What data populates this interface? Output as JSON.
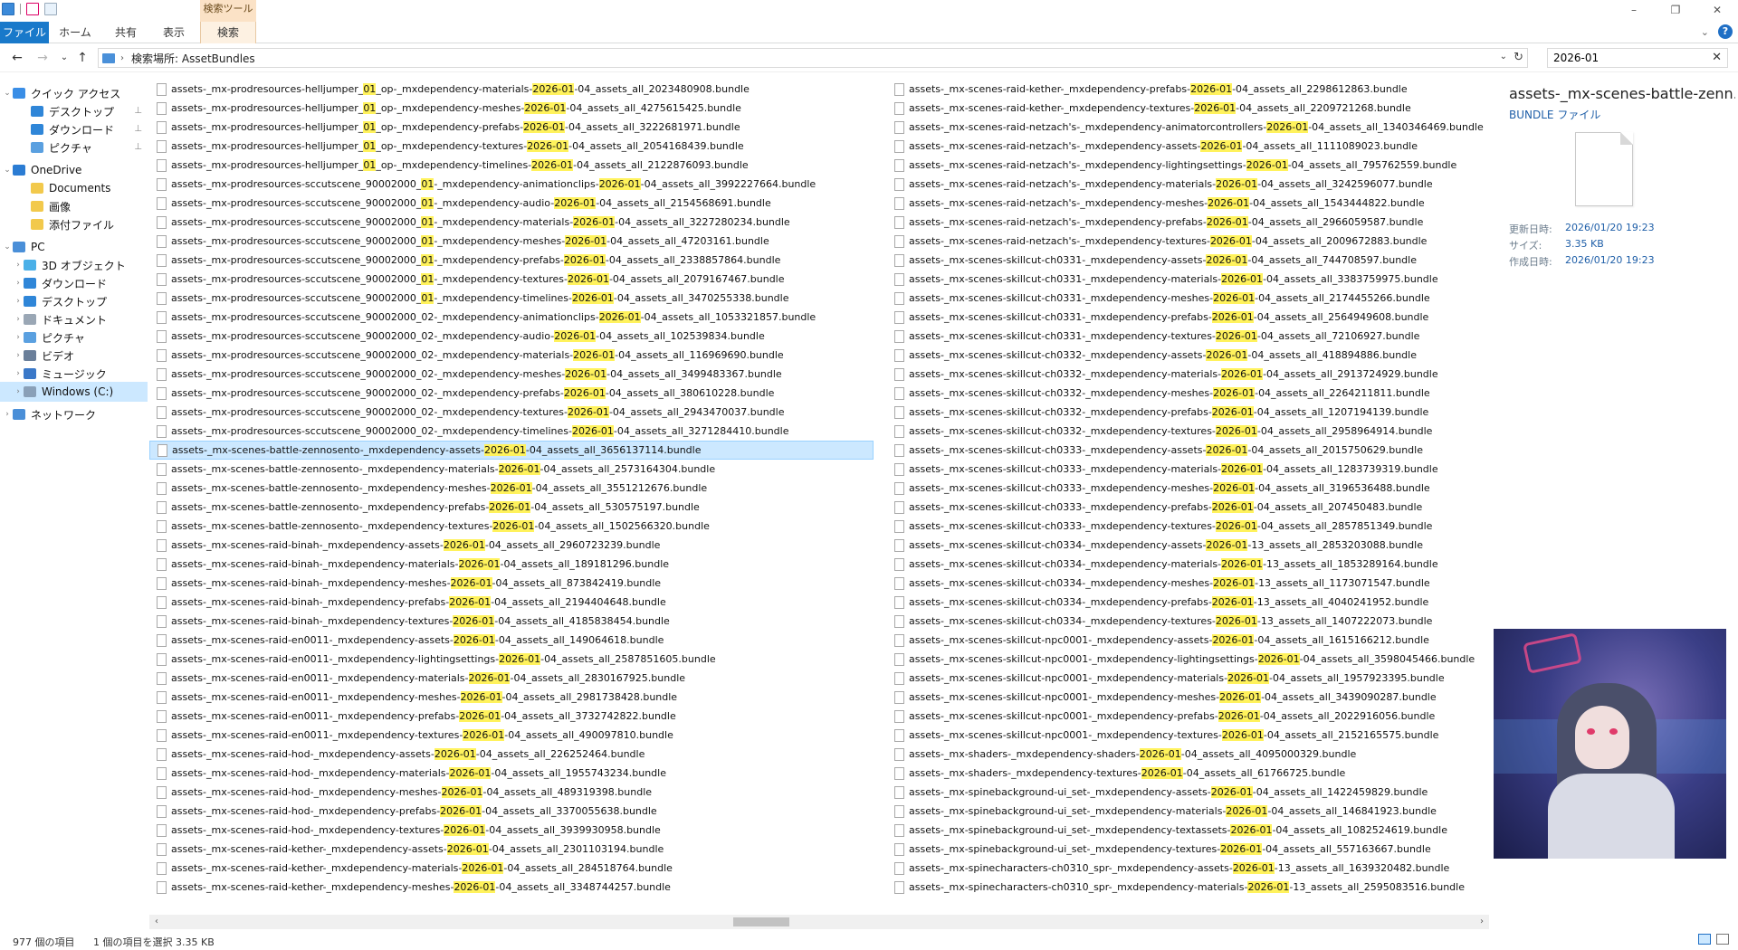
{
  "titlebar": {
    "context_tab_header": "検索ツール",
    "minimize": "–",
    "maximize": "❐",
    "close": "✕"
  },
  "ribbon": {
    "tabs": [
      "ファイル",
      "ホーム",
      "共有",
      "表示",
      "検索"
    ]
  },
  "address": {
    "back": "←",
    "forward": "→",
    "recent": "⌄",
    "up": "↑",
    "separator": "›",
    "path": "検索場所: AssetBundles",
    "dropdown": "⌄",
    "refresh": "↻"
  },
  "search": {
    "value": "2026-01",
    "clear": "✕"
  },
  "nav": {
    "items": [
      {
        "label": "クイック アクセス",
        "icon": "star-icon",
        "expander": "⌄"
      },
      {
        "label": "デスクトップ",
        "icon": "desktop-icon",
        "pin": "📌"
      },
      {
        "label": "ダウンロード",
        "icon": "download-icon",
        "pin": "📌"
      },
      {
        "label": "ピクチャ",
        "icon": "pictures-icon",
        "pin": "📌"
      },
      {
        "label": "OneDrive",
        "icon": "cloud-icon",
        "expander": "⌄"
      },
      {
        "label": "Documents",
        "icon": "folder-icon"
      },
      {
        "label": "画像",
        "icon": "folder-icon"
      },
      {
        "label": "添付ファイル",
        "icon": "folder-icon"
      },
      {
        "label": "PC",
        "icon": "pc-icon",
        "expander": "⌄"
      },
      {
        "label": "3D オブジェクト",
        "icon": "3d-objects-icon",
        "expander": "›"
      },
      {
        "label": "ダウンロード",
        "icon": "download-icon",
        "expander": "›"
      },
      {
        "label": "デスクトップ",
        "icon": "desktop-icon",
        "expander": "›"
      },
      {
        "label": "ドキュメント",
        "icon": "documents-icon",
        "expander": "›"
      },
      {
        "label": "ピクチャ",
        "icon": "pictures-icon",
        "expander": "›"
      },
      {
        "label": "ビデオ",
        "icon": "videos-icon",
        "expander": "›"
      },
      {
        "label": "ミュージック",
        "icon": "music-icon",
        "expander": "›"
      },
      {
        "label": "Windows (C:)",
        "icon": "drive-icon",
        "expander": "›"
      },
      {
        "label": "ネットワーク",
        "icon": "network-icon",
        "expander": "›"
      }
    ]
  },
  "files": {
    "highlight": "2026-01",
    "column1": [
      [
        "assets-_mx-prodresources-helljumper_",
        "01",
        "_op-_mxdependency-materials-",
        "2026-01",
        "-04_assets_all_2023480908.bundle"
      ],
      [
        "assets-_mx-prodresources-helljumper_",
        "01",
        "_op-_mxdependency-meshes-",
        "2026-01",
        "-04_assets_all_4275615425.bundle"
      ],
      [
        "assets-_mx-prodresources-helljumper_",
        "01",
        "_op-_mxdependency-prefabs-",
        "2026-01",
        "-04_assets_all_3222681971.bundle"
      ],
      [
        "assets-_mx-prodresources-helljumper_",
        "01",
        "_op-_mxdependency-textures-",
        "2026-01",
        "-04_assets_all_2054168439.bundle"
      ],
      [
        "assets-_mx-prodresources-helljumper_",
        "01",
        "_op-_mxdependency-timelines-",
        "2026-01",
        "-04_assets_all_2122876093.bundle"
      ],
      [
        "assets-_mx-prodresources-sccutscene_90002000_",
        "01",
        "-_mxdependency-animationclips-",
        "2026-01",
        "-04_assets_all_3992227664.bundle"
      ],
      [
        "assets-_mx-prodresources-sccutscene_90002000_",
        "01",
        "-_mxdependency-audio-",
        "2026-01",
        "-04_assets_all_2154568691.bundle"
      ],
      [
        "assets-_mx-prodresources-sccutscene_90002000_",
        "01",
        "-_mxdependency-materials-",
        "2026-01",
        "-04_assets_all_3227280234.bundle"
      ],
      [
        "assets-_mx-prodresources-sccutscene_90002000_",
        "01",
        "-_mxdependency-meshes-",
        "2026-01",
        "-04_assets_all_47203161.bundle"
      ],
      [
        "assets-_mx-prodresources-sccutscene_90002000_",
        "01",
        "-_mxdependency-prefabs-",
        "2026-01",
        "-04_assets_all_2338857864.bundle"
      ],
      [
        "assets-_mx-prodresources-sccutscene_90002000_",
        "01",
        "-_mxdependency-textures-",
        "2026-01",
        "-04_assets_all_2079167467.bundle"
      ],
      [
        "assets-_mx-prodresources-sccutscene_90002000_",
        "01",
        "-_mxdependency-timelines-",
        "2026-01",
        "-04_assets_all_3470255338.bundle"
      ],
      [
        "assets-_mx-prodresources-sccutscene_90002000_02-_mxdependency-animationclips-",
        "",
        "",
        "2026-01",
        "-04_assets_all_1053321857.bundle"
      ],
      [
        "assets-_mx-prodresources-sccutscene_90002000_02-_mxdependency-audio-",
        "",
        "",
        "2026-01",
        "-04_assets_all_102539834.bundle"
      ],
      [
        "assets-_mx-prodresources-sccutscene_90002000_02-_mxdependency-materials-",
        "",
        "",
        "2026-01",
        "-04_assets_all_116969690.bundle"
      ],
      [
        "assets-_mx-prodresources-sccutscene_90002000_02-_mxdependency-meshes-",
        "",
        "",
        "2026-01",
        "-04_assets_all_3499483367.bundle"
      ],
      [
        "assets-_mx-prodresources-sccutscene_90002000_02-_mxdependency-prefabs-",
        "",
        "",
        "2026-01",
        "-04_assets_all_380610228.bundle"
      ],
      [
        "assets-_mx-prodresources-sccutscene_90002000_02-_mxdependency-textures-",
        "",
        "",
        "2026-01",
        "-04_assets_all_2943470037.bundle"
      ],
      [
        "assets-_mx-prodresources-sccutscene_90002000_02-_mxdependency-timelines-",
        "",
        "",
        "2026-01",
        "-04_assets_all_3271284410.bundle"
      ],
      [
        "assets-_mx-scenes-battle-zennosento-_mxdependency-assets-",
        "",
        "",
        "2026-01",
        "-04_assets_all_3656137114.bundle"
      ],
      [
        "assets-_mx-scenes-battle-zennosento-_mxdependency-materials-",
        "",
        "",
        "2026-01",
        "-04_assets_all_2573164304.bundle"
      ],
      [
        "assets-_mx-scenes-battle-zennosento-_mxdependency-meshes-",
        "",
        "",
        "2026-01",
        "-04_assets_all_3551212676.bundle"
      ],
      [
        "assets-_mx-scenes-battle-zennosento-_mxdependency-prefabs-",
        "",
        "",
        "2026-01",
        "-04_assets_all_530575197.bundle"
      ],
      [
        "assets-_mx-scenes-battle-zennosento-_mxdependency-textures-",
        "",
        "",
        "2026-01",
        "-04_assets_all_1502566320.bundle"
      ],
      [
        "assets-_mx-scenes-raid-binah-_mxdependency-assets-",
        "",
        "",
        "2026-01",
        "-04_assets_all_2960723239.bundle"
      ],
      [
        "assets-_mx-scenes-raid-binah-_mxdependency-materials-",
        "",
        "",
        "2026-01",
        "-04_assets_all_189181296.bundle"
      ],
      [
        "assets-_mx-scenes-raid-binah-_mxdependency-meshes-",
        "",
        "",
        "2026-01",
        "-04_assets_all_873842419.bundle"
      ],
      [
        "assets-_mx-scenes-raid-binah-_mxdependency-prefabs-",
        "",
        "",
        "2026-01",
        "-04_assets_all_2194404648.bundle"
      ],
      [
        "assets-_mx-scenes-raid-binah-_mxdependency-textures-",
        "",
        "",
        "2026-01",
        "-04_assets_all_4185838454.bundle"
      ],
      [
        "assets-_mx-scenes-raid-en0011-_mxdependency-assets-",
        "",
        "",
        "2026-01",
        "-04_assets_all_149064618.bundle"
      ],
      [
        "assets-_mx-scenes-raid-en0011-_mxdependency-lightingsettings-",
        "",
        "",
        "2026-01",
        "-04_assets_all_2587851605.bundle"
      ],
      [
        "assets-_mx-scenes-raid-en0011-_mxdependency-materials-",
        "",
        "",
        "2026-01",
        "-04_assets_all_2830167925.bundle"
      ],
      [
        "assets-_mx-scenes-raid-en0011-_mxdependency-meshes-",
        "",
        "",
        "2026-01",
        "-04_assets_all_2981738428.bundle"
      ],
      [
        "assets-_mx-scenes-raid-en0011-_mxdependency-prefabs-",
        "",
        "",
        "2026-01",
        "-04_assets_all_3732742822.bundle"
      ],
      [
        "assets-_mx-scenes-raid-en0011-_mxdependency-textures-",
        "",
        "",
        "2026-01",
        "-04_assets_all_490097810.bundle"
      ],
      [
        "assets-_mx-scenes-raid-hod-_mxdependency-assets-",
        "",
        "",
        "2026-01",
        "-04_assets_all_226252464.bundle"
      ],
      [
        "assets-_mx-scenes-raid-hod-_mxdependency-materials-",
        "",
        "",
        "2026-01",
        "-04_assets_all_1955743234.bundle"
      ],
      [
        "assets-_mx-scenes-raid-hod-_mxdependency-meshes-",
        "",
        "",
        "2026-01",
        "-04_assets_all_489319398.bundle"
      ],
      [
        "assets-_mx-scenes-raid-hod-_mxdependency-prefabs-",
        "",
        "",
        "2026-01",
        "-04_assets_all_3370055638.bundle"
      ],
      [
        "assets-_mx-scenes-raid-hod-_mxdependency-textures-",
        "",
        "",
        "2026-01",
        "-04_assets_all_3939930958.bundle"
      ],
      [
        "assets-_mx-scenes-raid-kether-_mxdependency-assets-",
        "",
        "",
        "2026-01",
        "-04_assets_all_2301103194.bundle"
      ],
      [
        "assets-_mx-scenes-raid-kether-_mxdependency-materials-",
        "",
        "",
        "2026-01",
        "-04_assets_all_284518764.bundle"
      ],
      [
        "assets-_mx-scenes-raid-kether-_mxdependency-meshes-",
        "",
        "",
        "2026-01",
        "-04_assets_all_3348744257.bundle"
      ]
    ],
    "column2": [
      [
        "assets-_mx-scenes-raid-kether-_mxdependency-prefabs-",
        "2026-01",
        "-04_assets_all_2298612863.bundle"
      ],
      [
        "assets-_mx-scenes-raid-kether-_mxdependency-textures-",
        "2026-01",
        "-04_assets_all_2209721268.bundle"
      ],
      [
        "assets-_mx-scenes-raid-netzach's-_mxdependency-animatorcontrollers-",
        "2026-01",
        "-04_assets_all_1340346469.bundle"
      ],
      [
        "assets-_mx-scenes-raid-netzach's-_mxdependency-assets-",
        "2026-01",
        "-04_assets_all_1111089023.bundle"
      ],
      [
        "assets-_mx-scenes-raid-netzach's-_mxdependency-lightingsettings-",
        "2026-01",
        "-04_assets_all_795762559.bundle"
      ],
      [
        "assets-_mx-scenes-raid-netzach's-_mxdependency-materials-",
        "2026-01",
        "-04_assets_all_3242596077.bundle"
      ],
      [
        "assets-_mx-scenes-raid-netzach's-_mxdependency-meshes-",
        "2026-01",
        "-04_assets_all_1543444822.bundle"
      ],
      [
        "assets-_mx-scenes-raid-netzach's-_mxdependency-prefabs-",
        "2026-01",
        "-04_assets_all_2966059587.bundle"
      ],
      [
        "assets-_mx-scenes-raid-netzach's-_mxdependency-textures-",
        "2026-01",
        "-04_assets_all_2009672883.bundle"
      ],
      [
        "assets-_mx-scenes-skillcut-ch0331-_mxdependency-assets-",
        "2026-01",
        "-04_assets_all_744708597.bundle"
      ],
      [
        "assets-_mx-scenes-skillcut-ch0331-_mxdependency-materials-",
        "2026-01",
        "-04_assets_all_3383759975.bundle"
      ],
      [
        "assets-_mx-scenes-skillcut-ch0331-_mxdependency-meshes-",
        "2026-01",
        "-04_assets_all_2174455266.bundle"
      ],
      [
        "assets-_mx-scenes-skillcut-ch0331-_mxdependency-prefabs-",
        "2026-01",
        "-04_assets_all_2564949608.bundle"
      ],
      [
        "assets-_mx-scenes-skillcut-ch0331-_mxdependency-textures-",
        "2026-01",
        "-04_assets_all_72106927.bundle"
      ],
      [
        "assets-_mx-scenes-skillcut-ch0332-_mxdependency-assets-",
        "2026-01",
        "-04_assets_all_418894886.bundle"
      ],
      [
        "assets-_mx-scenes-skillcut-ch0332-_mxdependency-materials-",
        "2026-01",
        "-04_assets_all_2913724929.bundle"
      ],
      [
        "assets-_mx-scenes-skillcut-ch0332-_mxdependency-meshes-",
        "2026-01",
        "-04_assets_all_2264211811.bundle"
      ],
      [
        "assets-_mx-scenes-skillcut-ch0332-_mxdependency-prefabs-",
        "2026-01",
        "-04_assets_all_1207194139.bundle"
      ],
      [
        "assets-_mx-scenes-skillcut-ch0332-_mxdependency-textures-",
        "2026-01",
        "-04_assets_all_2958964914.bundle"
      ],
      [
        "assets-_mx-scenes-skillcut-ch0333-_mxdependency-assets-",
        "2026-01",
        "-04_assets_all_2015750629.bundle"
      ],
      [
        "assets-_mx-scenes-skillcut-ch0333-_mxdependency-materials-",
        "2026-01",
        "-04_assets_all_1283739319.bundle"
      ],
      [
        "assets-_mx-scenes-skillcut-ch0333-_mxdependency-meshes-",
        "2026-01",
        "-04_assets_all_3196536488.bundle"
      ],
      [
        "assets-_mx-scenes-skillcut-ch0333-_mxdependency-prefabs-",
        "2026-01",
        "-04_assets_all_207450483.bundle"
      ],
      [
        "assets-_mx-scenes-skillcut-ch0333-_mxdependency-textures-",
        "2026-01",
        "-04_assets_all_2857851349.bundle"
      ],
      [
        "assets-_mx-scenes-skillcut-ch0334-_mxdependency-assets-",
        "2026-01",
        "-13_assets_all_2853203088.bundle"
      ],
      [
        "assets-_mx-scenes-skillcut-ch0334-_mxdependency-materials-",
        "2026-01",
        "-13_assets_all_1853289164.bundle"
      ],
      [
        "assets-_mx-scenes-skillcut-ch0334-_mxdependency-meshes-",
        "2026-01",
        "-13_assets_all_1173071547.bundle"
      ],
      [
        "assets-_mx-scenes-skillcut-ch0334-_mxdependency-prefabs-",
        "2026-01",
        "-13_assets_all_4040241952.bundle"
      ],
      [
        "assets-_mx-scenes-skillcut-ch0334-_mxdependency-textures-",
        "2026-01",
        "-13_assets_all_1407222073.bundle"
      ],
      [
        "assets-_mx-scenes-skillcut-npc0001-_mxdependency-assets-",
        "2026-01",
        "-04_assets_all_1615166212.bundle"
      ],
      [
        "assets-_mx-scenes-skillcut-npc0001-_mxdependency-lightingsettings-",
        "2026-01",
        "-04_assets_all_3598045466.bundle"
      ],
      [
        "assets-_mx-scenes-skillcut-npc0001-_mxdependency-materials-",
        "2026-01",
        "-04_assets_all_1957923395.bundle"
      ],
      [
        "assets-_mx-scenes-skillcut-npc0001-_mxdependency-meshes-",
        "2026-01",
        "-04_assets_all_3439090287.bundle"
      ],
      [
        "assets-_mx-scenes-skillcut-npc0001-_mxdependency-prefabs-",
        "2026-01",
        "-04_assets_all_2022916056.bundle"
      ],
      [
        "assets-_mx-scenes-skillcut-npc0001-_mxdependency-textures-",
        "2026-01",
        "-04_assets_all_2152165575.bundle"
      ],
      [
        "assets-_mx-shaders-_mxdependency-shaders-",
        "2026-01",
        "-04_assets_all_4095000329.bundle"
      ],
      [
        "assets-_mx-shaders-_mxdependency-textures-",
        "2026-01",
        "-04_assets_all_61766725.bundle"
      ],
      [
        "assets-_mx-spinebackground-ui_set-_mxdependency-assets-",
        "2026-01",
        "-04_assets_all_1422459829.bundle"
      ],
      [
        "assets-_mx-spinebackground-ui_set-_mxdependency-materials-",
        "2026-01",
        "-04_assets_all_146841923.bundle"
      ],
      [
        "assets-_mx-spinebackground-ui_set-_mxdependency-textassets-",
        "2026-01",
        "-04_assets_all_1082524619.bundle"
      ],
      [
        "assets-_mx-spinebackground-ui_set-_mxdependency-textures-",
        "2026-01",
        "-04_assets_all_557163667.bundle"
      ],
      [
        "assets-_mx-spinecharacters-ch0310_spr-_mxdependency-assets-",
        "2026-01",
        "-13_assets_all_1639320482.bundle"
      ],
      [
        "assets-_mx-spinecharacters-ch0310_spr-_mxdependency-materials-",
        "2026-01",
        "-13_assets_all_2595083516.bundle"
      ]
    ],
    "selected_index_column1": 19
  },
  "preview": {
    "title": "assets-_mx-scenes-battle-zenn...",
    "type": "BUNDLE ファイル",
    "props": [
      {
        "key": "更新日時:",
        "value": "2026/01/20 19:23"
      },
      {
        "key": "サイズ:",
        "value": "3.35 KB"
      },
      {
        "key": "作成日時:",
        "value": "2026/01/20 19:23"
      }
    ]
  },
  "statusbar": {
    "count": "977 個の項目",
    "selection": "1 個の項目を選択  3.35 KB"
  },
  "colors": {
    "accent": "#1979ca",
    "selection": "#cce8ff",
    "highlight": "#fff25c",
    "search_tab": "#fdf1e2"
  }
}
